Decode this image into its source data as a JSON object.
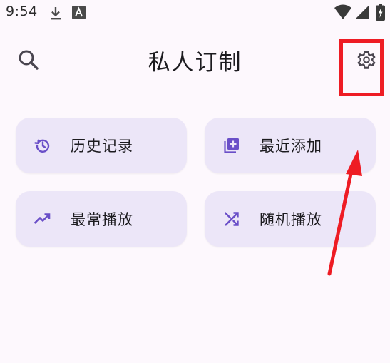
{
  "status_bar": {
    "time": "9:54",
    "icons": [
      "download-icon",
      "a-badge-icon",
      "wifi-icon",
      "signal-icon",
      "battery-icon"
    ]
  },
  "header": {
    "title": "私人订制",
    "search_icon": "search-icon",
    "settings_icon": "gear-icon"
  },
  "cards": [
    {
      "label": "历史记录",
      "icon": "history-icon"
    },
    {
      "label": "最近添加",
      "icon": "library-add-icon"
    },
    {
      "label": "最常播放",
      "icon": "trending-up-icon"
    },
    {
      "label": "随机播放",
      "icon": "shuffle-icon"
    }
  ],
  "colors": {
    "background": "#fdf8fd",
    "card": "#ece6f8",
    "accent": "#6a4fc8",
    "annotation": "#ee1c24"
  }
}
